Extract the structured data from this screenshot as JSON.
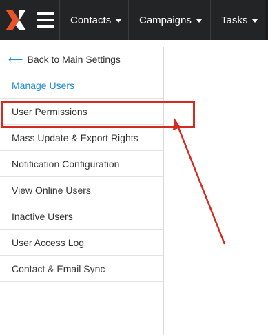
{
  "topbar": {
    "logo_icon": "x-logo-icon",
    "menu_icon": "hamburger-icon",
    "nav": [
      {
        "label": "Contacts"
      },
      {
        "label": "Campaigns"
      },
      {
        "label": "Tasks"
      }
    ]
  },
  "sidebar": {
    "back_label": "Back to Main Settings",
    "items": [
      {
        "label": "Manage Users",
        "active": true
      },
      {
        "label": "User Permissions"
      },
      {
        "label": "Mass Update & Export Rights"
      },
      {
        "label": "Notification Configuration"
      },
      {
        "label": "View Online Users"
      },
      {
        "label": "Inactive Users"
      },
      {
        "label": "User Access Log"
      },
      {
        "label": "Contact & Email Sync"
      }
    ]
  },
  "annotation": {
    "color": "#d42a20",
    "target": "User Permissions"
  },
  "colors": {
    "topbar_bg": "#222426",
    "logo_orange": "#e8542a",
    "link_blue": "#1c8ad6"
  }
}
